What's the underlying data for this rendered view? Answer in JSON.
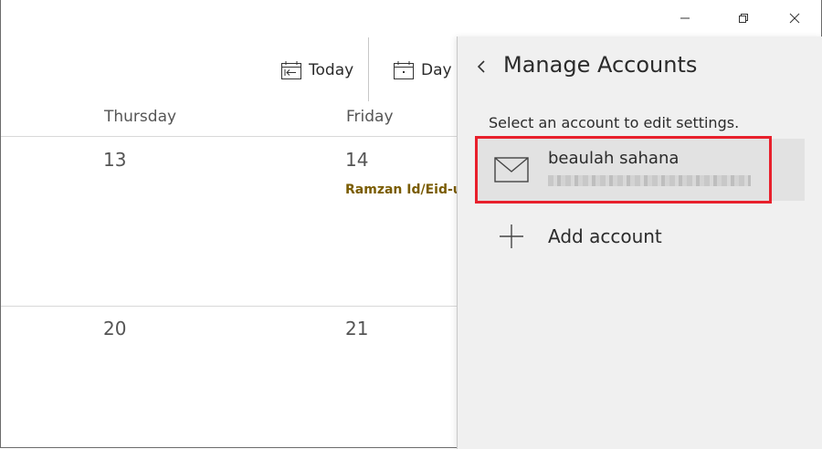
{
  "window": {
    "controls": [
      "minimize",
      "restore",
      "close"
    ]
  },
  "toolbar": {
    "today_label": "Today",
    "day_label": "Day"
  },
  "calendar": {
    "day_names": [
      "Thursday",
      "Friday"
    ],
    "dates": [
      "13",
      "14",
      "20",
      "21"
    ],
    "event": "Ramzan Id/Eid-u"
  },
  "panel": {
    "title": "Manage Accounts",
    "subtitle": "Select an account to edit settings.",
    "account": {
      "name": "beaulah sahana",
      "email": ""
    },
    "add_label": "Add account"
  },
  "icons": {
    "today": "calendar-back-icon",
    "day": "calendar-day-icon",
    "back": "chevron-left-icon",
    "mail": "mail-icon",
    "add": "plus-icon"
  },
  "colors": {
    "highlight": "#e8202c",
    "event": "#7a5c00",
    "panel_bg": "#f0f0f0"
  }
}
